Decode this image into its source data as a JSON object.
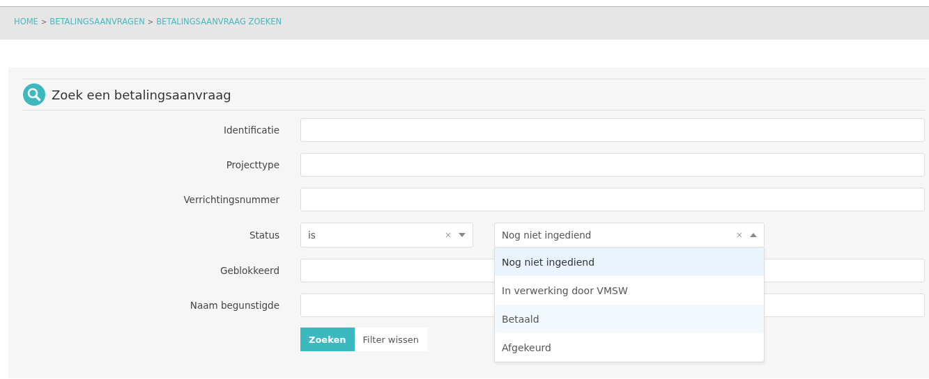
{
  "breadcrumb": [
    "HOME",
    "BETALINGSAANVRAGEN",
    "BETALINGSAANVRAAG ZOEKEN"
  ],
  "breadcrumb_separator": ">",
  "panel": {
    "title": "Zoek een betalingsaanvraag"
  },
  "fields": [
    {
      "kind": "text",
      "label": "Identificatie"
    },
    {
      "kind": "text",
      "label": "Projecttype"
    },
    {
      "kind": "text",
      "label": "Verrichtingsnummer"
    },
    {
      "kind": "status",
      "label": "Status",
      "operator": {
        "value": "is",
        "clear": "×",
        "expanded": false
      },
      "selection": {
        "value": "Nog niet ingediend",
        "clear": "×",
        "expanded": true,
        "options": [
          {
            "label": "Nog niet ingediend",
            "selected": true,
            "hovered": false
          },
          {
            "label": "In verwerking door VMSW",
            "selected": false,
            "hovered": false
          },
          {
            "label": "Betaald",
            "selected": false,
            "hovered": true
          },
          {
            "label": "Afgekeurd",
            "selected": false,
            "hovered": false
          }
        ]
      }
    },
    {
      "kind": "text",
      "label": "Geblokkeerd"
    },
    {
      "kind": "text",
      "label": "Naam begunstigde"
    }
  ],
  "buttons": [
    {
      "kind": "primary",
      "label": "Zoeken"
    },
    {
      "kind": "secondary",
      "label": "Filter wissen"
    }
  ]
}
